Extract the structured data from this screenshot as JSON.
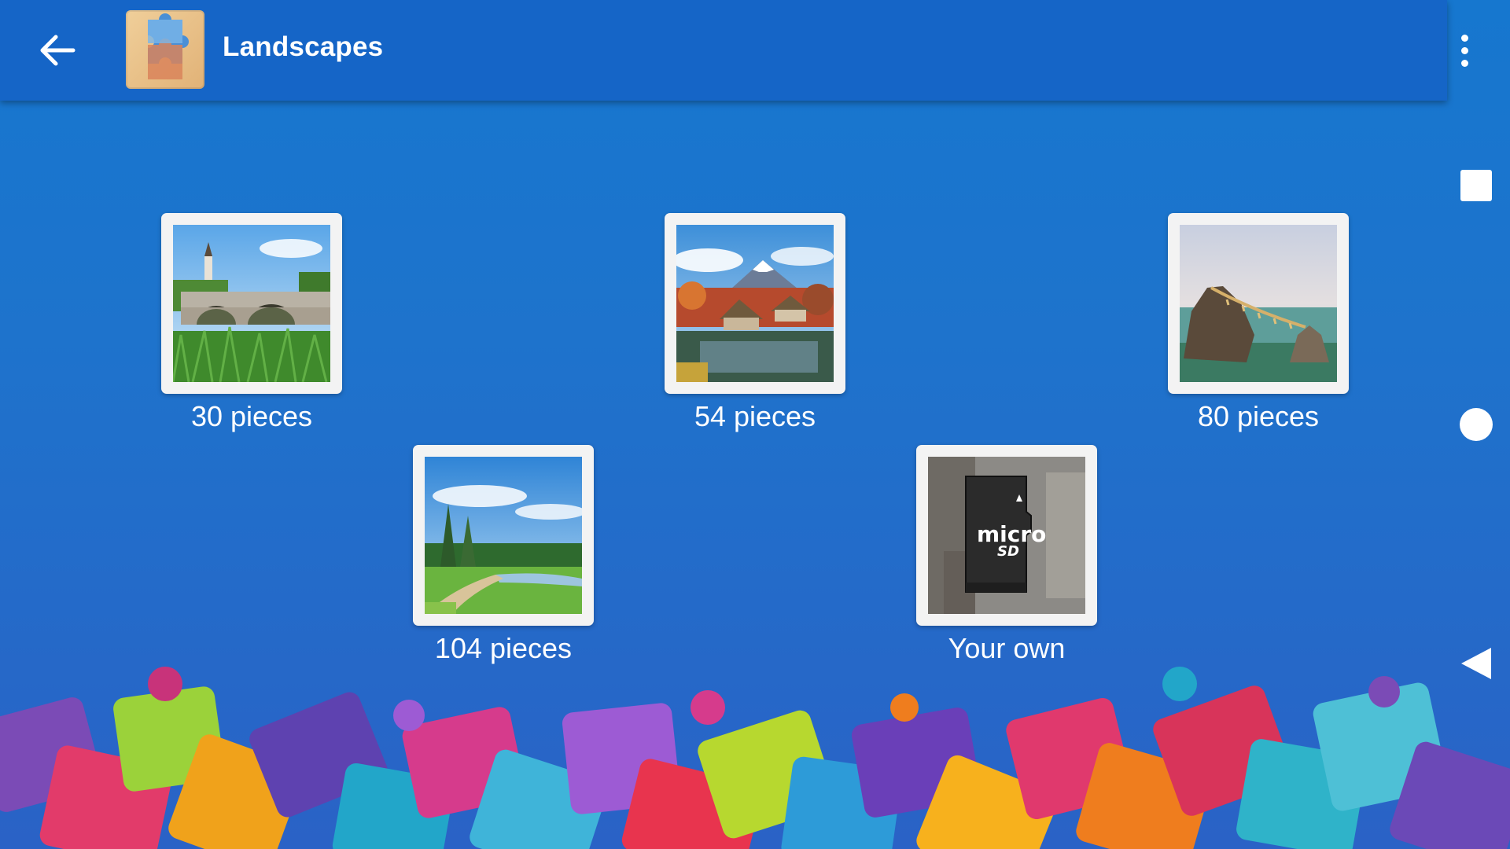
{
  "app_bar": {
    "title": "Landscapes",
    "back_icon": "arrow-back-icon",
    "logo_icon": "puzzle-piece-logo",
    "overflow_icon": "more-vert-icon"
  },
  "puzzles": [
    {
      "label": "30 pieces",
      "thumb": "bridge-village-landscape"
    },
    {
      "label": "54 pieces",
      "thumb": "mount-fuji-village"
    },
    {
      "label": "80 pieces",
      "thumb": "rock-by-sea"
    },
    {
      "label": "104 pieces",
      "thumb": "river-meadow-forest"
    },
    {
      "label": "Your own",
      "thumb": "microsd-card-icon"
    }
  ],
  "nav": {
    "recent_icon": "square-icon",
    "home_icon": "circle-icon",
    "back_icon": "triangle-back-icon"
  },
  "colors": {
    "app_bar": "#1565c7",
    "background": "#1e73cc",
    "tile_frame": "#f3f3f3"
  }
}
